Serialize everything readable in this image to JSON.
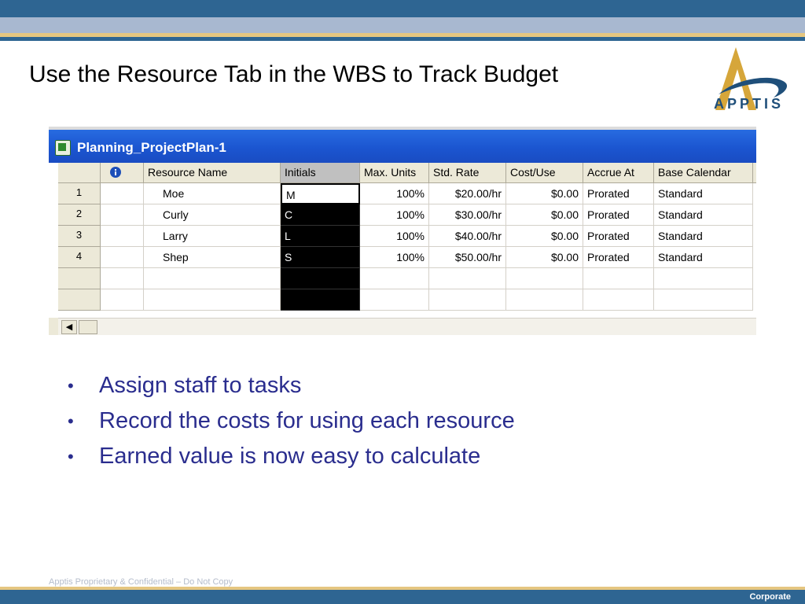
{
  "slide": {
    "title": "Use the Resource Tab in the WBS to Track Budget",
    "bullets": [
      "Assign staff to tasks",
      "Record the costs for using each resource",
      "Earned value is now easy to calculate"
    ],
    "footer_note": "Apptis Proprietary & Confidential – Do Not Copy",
    "corporate_label": "Corporate",
    "logo_text": "APPTIS"
  },
  "window": {
    "title": "Planning_ProjectPlan-1",
    "icon": "excel-sheet-icon",
    "columns": {
      "info_icon": "info-icon",
      "resource_name": "Resource Name",
      "initials": "Initials",
      "max_units": "Max. Units",
      "std_rate": "Std. Rate",
      "cost_use": "Cost/Use",
      "accrue_at": "Accrue At",
      "base_calendar": "Base Calendar"
    },
    "rows": [
      {
        "num": "1",
        "name": "Moe",
        "initials": "M",
        "max_units": "100%",
        "std_rate": "$20.00/hr",
        "cost_use": "$0.00",
        "accrue_at": "Prorated",
        "base_calendar": "Standard"
      },
      {
        "num": "2",
        "name": "Curly",
        "initials": "C",
        "max_units": "100%",
        "std_rate": "$30.00/hr",
        "cost_use": "$0.00",
        "accrue_at": "Prorated",
        "base_calendar": "Standard"
      },
      {
        "num": "3",
        "name": "Larry",
        "initials": "L",
        "max_units": "100%",
        "std_rate": "$40.00/hr",
        "cost_use": "$0.00",
        "accrue_at": "Prorated",
        "base_calendar": "Standard"
      },
      {
        "num": "4",
        "name": "Shep",
        "initials": "S",
        "max_units": "100%",
        "std_rate": "$50.00/hr",
        "cost_use": "$0.00",
        "accrue_at": "Prorated",
        "base_calendar": "Standard"
      }
    ]
  },
  "colors": {
    "band_blue": "#2e6592",
    "band_gold": "#e5c680",
    "bullet_text": "#2a2d8e",
    "logo_gold": "#d6a63a"
  }
}
